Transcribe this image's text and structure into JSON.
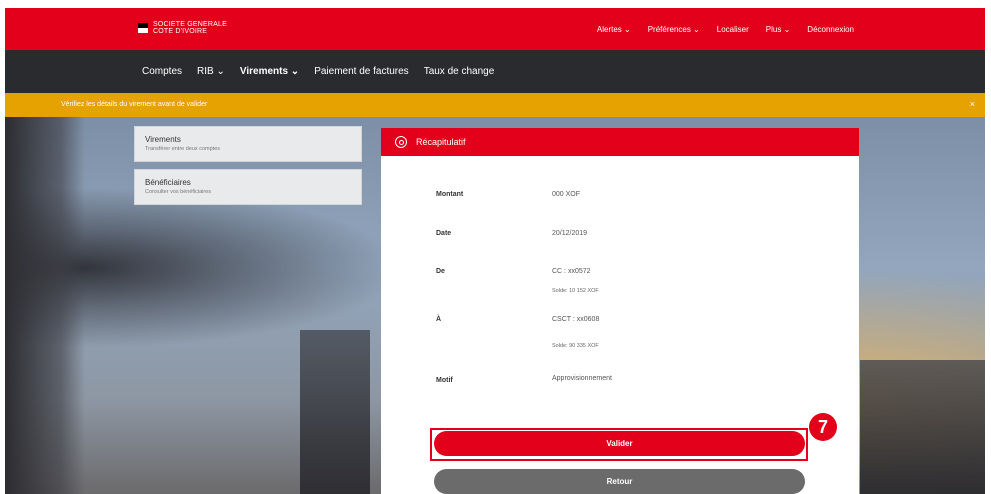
{
  "header": {
    "logo_line1": "SOCIETE GENERALE",
    "logo_line2": "COTE D'IVOIRE",
    "menu": [
      "Alertes ⌄",
      "Préférences ⌄",
      "Localiser",
      "Plus ⌄",
      "Déconnexion"
    ]
  },
  "nav": {
    "items": [
      "Comptes",
      "RIB ⌄",
      "Virements ⌄",
      "Paiement de factures",
      "Taux de change"
    ],
    "active_index": 2
  },
  "alert": {
    "text": "Vérifiez les détails du virement avant de valider",
    "close": "×"
  },
  "sidebar": {
    "cards": [
      {
        "title": "Virements",
        "subtitle": "Transférer entre deux comptes"
      },
      {
        "title": "Bénéficiaires",
        "subtitle": "Consulter vos bénéficiaires"
      }
    ]
  },
  "summary": {
    "title": "Récapitulatif",
    "rows": [
      {
        "label": "Montant",
        "value": "000 XOF",
        "sub": ""
      },
      {
        "label": "Date",
        "value": "20/12/2019",
        "sub": ""
      },
      {
        "label": "De",
        "value": "CC : xx0572",
        "sub": "Solde: 10 152 XOF"
      },
      {
        "label": "À",
        "value": "CSCT : xx0608",
        "sub": "Solde: 90 335 XOF"
      },
      {
        "label": "Motif",
        "value": "Approvisionnement",
        "sub": ""
      }
    ],
    "validate_label": "Valider",
    "back_label": "Retour"
  },
  "annotation": {
    "step_number": "7"
  },
  "colors": {
    "brand_red": "#e2001a",
    "nav_dark": "#2a2b2e",
    "alert_yellow": "#e5a200",
    "back_gray": "#6b6b6b"
  }
}
